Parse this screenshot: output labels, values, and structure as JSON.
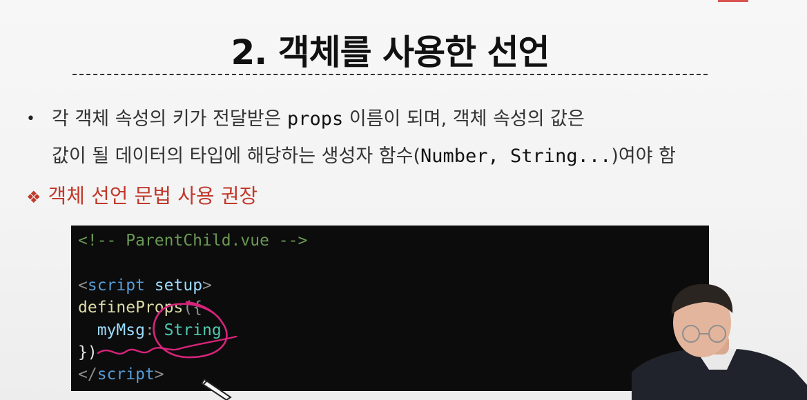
{
  "slide": {
    "title": "2. 객체를 사용한 선언",
    "bullet": {
      "line1_before": "각 객체 속성의 키가 전달받은 ",
      "line1_code": "props",
      "line1_after": " 이름이 되며, 객체 속성의 값은",
      "line2_before": "값이 될 데이터의 타입에 해당하는 생성자 함수(",
      "line2_code": "Number, String...",
      "line2_after": ")여야 함"
    },
    "subpoint": {
      "marker": "❖",
      "text": "객체 선언 문법 사용 권장"
    }
  },
  "code": {
    "comment": "<!-- ParentChild.vue -->",
    "script_open_lt": "<",
    "script_open_tag": "script",
    "script_open_attr": " setup",
    "script_open_gt": ">",
    "define_fn": "defineProps",
    "define_open": "({",
    "prop_indent": "  ",
    "prop_key": "myMsg",
    "prop_colon": ": ",
    "prop_type": "String",
    "close": "})",
    "script_close_lt": "</",
    "script_close_tag": "script",
    "script_close_gt": ">"
  },
  "colors": {
    "subpoint": "#c0392b",
    "annotation_pen": "#d6247a",
    "code_background": "#0c0c0c"
  },
  "icons": {
    "bullet": "bullet-dot-icon",
    "subpoint_marker": "diamond-cluster-icon",
    "cursor": "pencil-cursor-icon"
  }
}
